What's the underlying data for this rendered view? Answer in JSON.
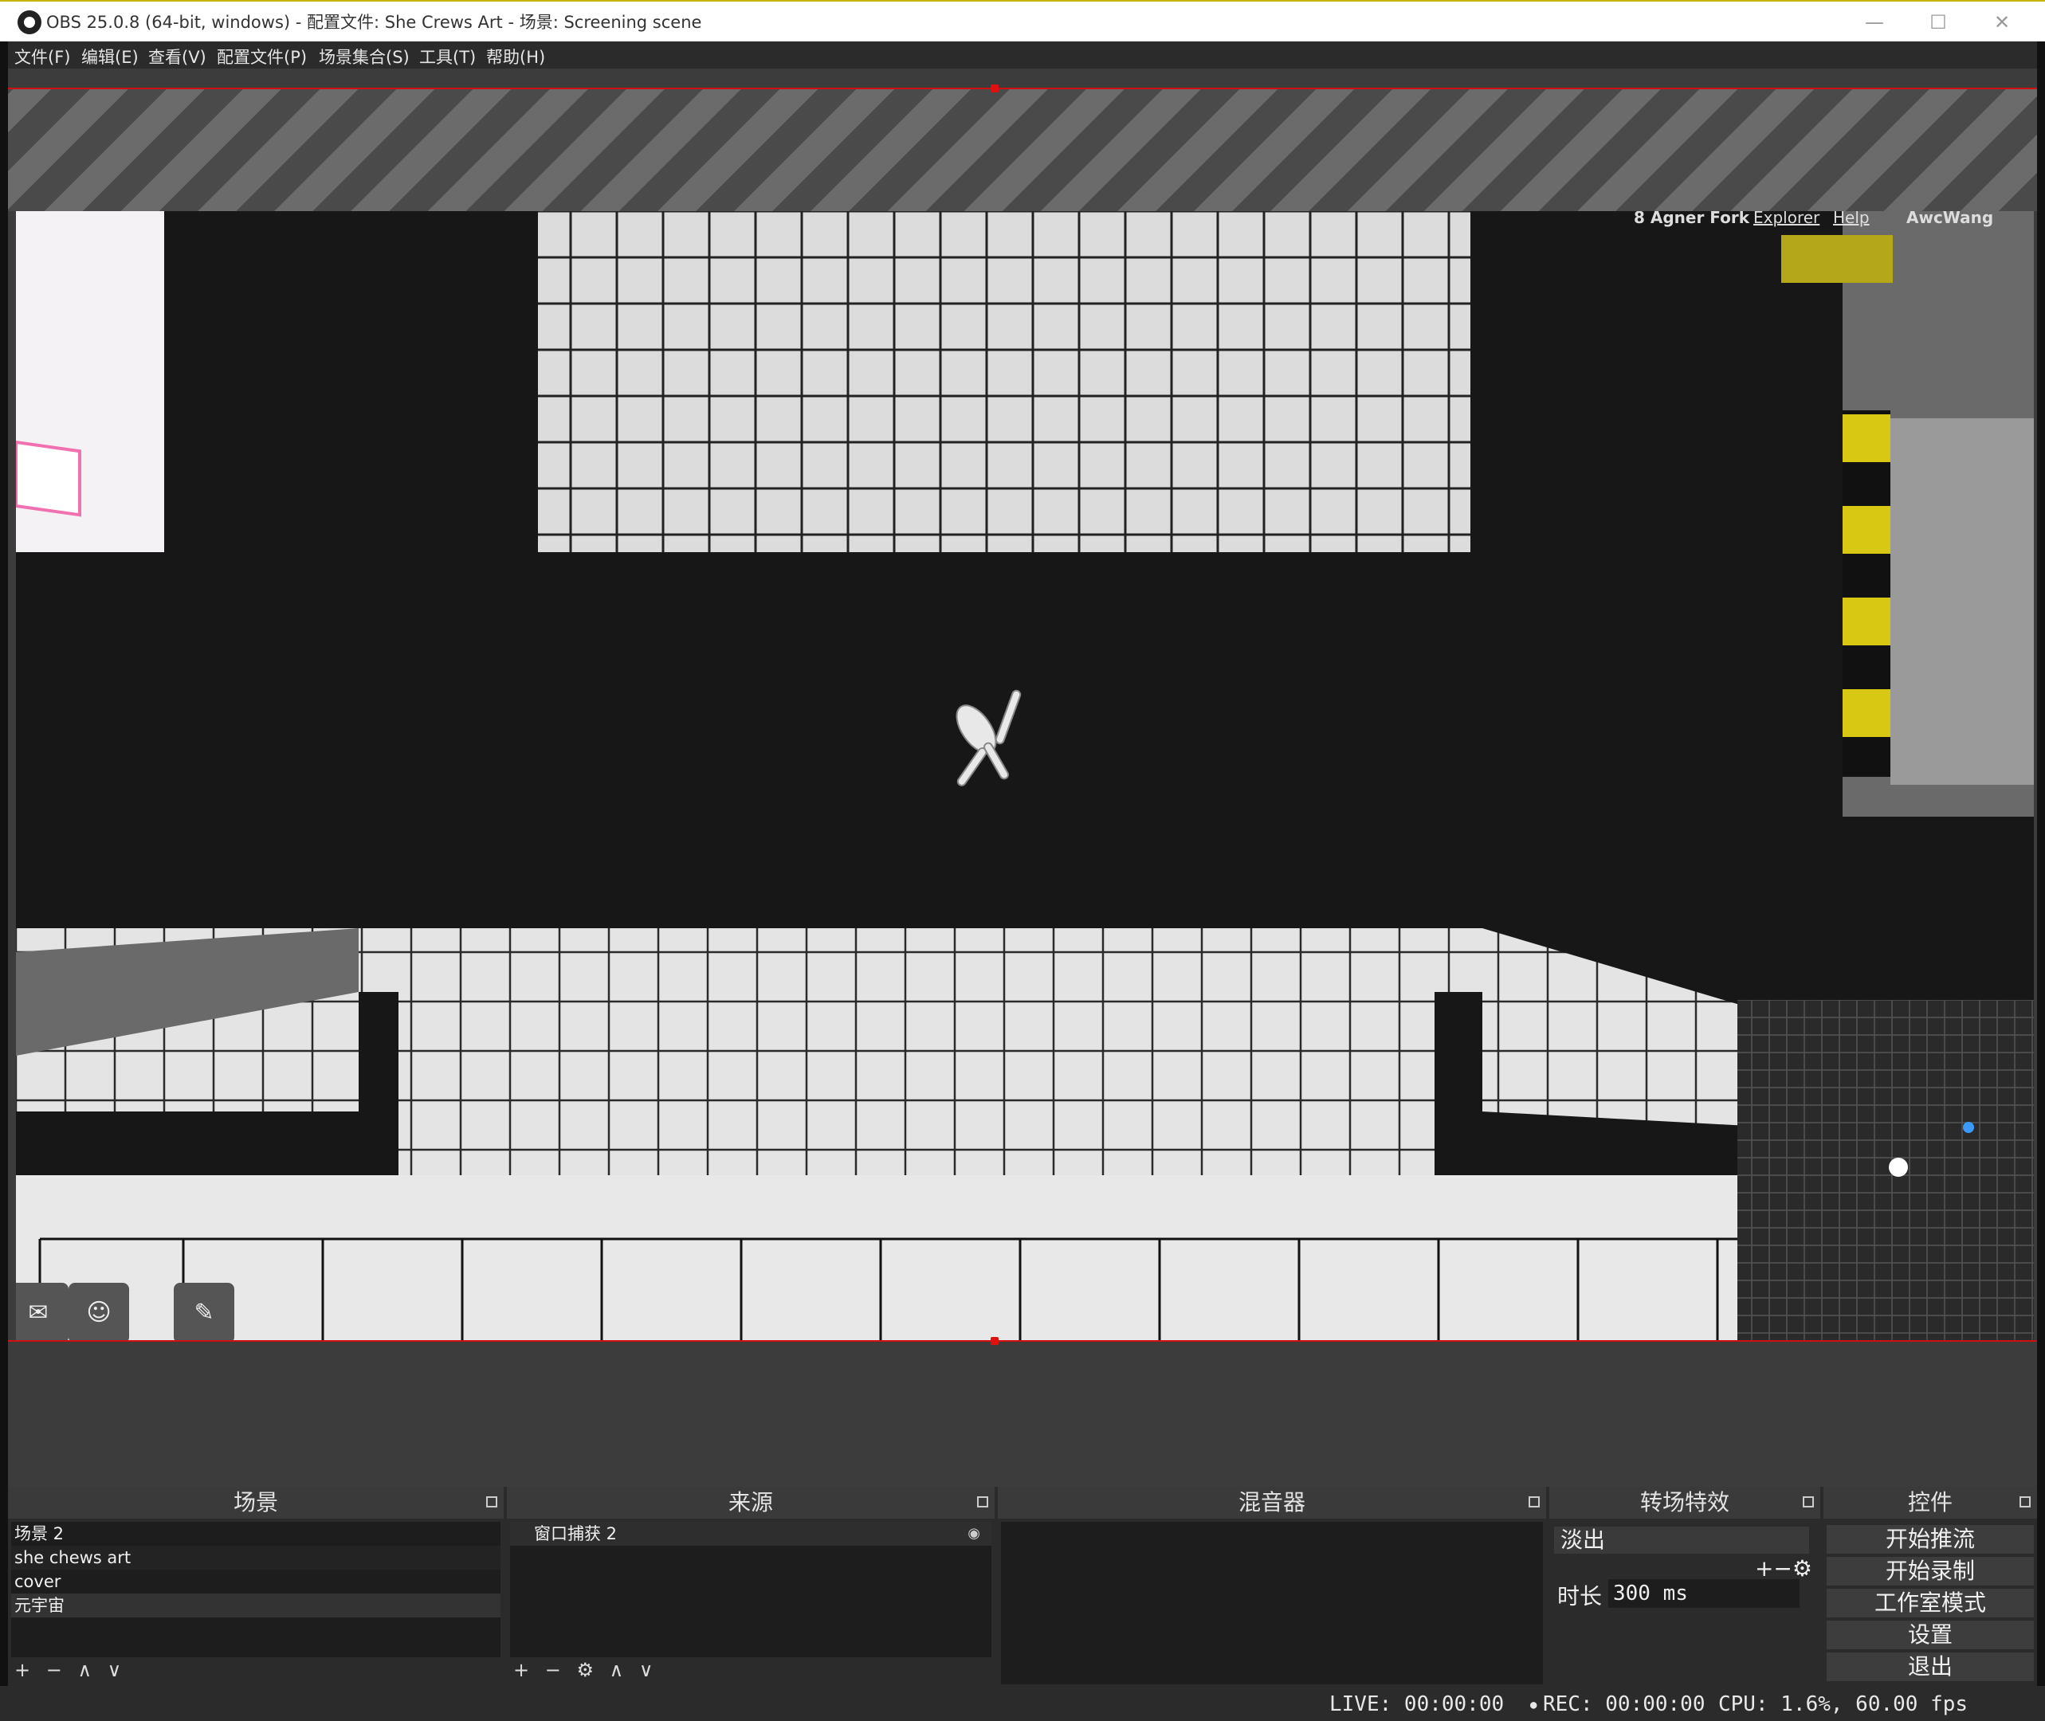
{
  "window": {
    "title": "OBS 25.0.8 (64-bit, windows) - 配置文件: She Crews Art - 场景: Screening scene",
    "minimize": "—",
    "maximize": "☐",
    "close": "✕"
  },
  "menu": {
    "items": [
      "文件(F)",
      "编辑(E)",
      "查看(V)",
      "配置文件(P)",
      "场景集合(S)",
      "工具(T)",
      "帮助(H)"
    ]
  },
  "game": {
    "topbar": {
      "location": "8 Agner Fork",
      "explorer": "Explorer",
      "help": "Help",
      "user": "AwcWang"
    },
    "chat_buttons": [
      "chat-icon",
      "emoji-icon",
      "mic-muted-icon"
    ]
  },
  "docks": {
    "scenes": {
      "title": "场景",
      "items": [
        "场景 2",
        "she chews art",
        "cover",
        "元宇宙"
      ],
      "toolbar": "+ − ∧ ∨"
    },
    "sources": {
      "title": "来源",
      "items": [
        "窗口捕获 2"
      ],
      "toolbar": "+ − ⚙ ∧ ∨"
    },
    "mixer": {
      "title": "混音器"
    },
    "transitions": {
      "title": "转场特效",
      "selected": "淡出",
      "duration_label": "时长",
      "duration_value": "300 ms",
      "add_remove": "+−⚙"
    },
    "controls": {
      "title": "控件",
      "buttons": [
        "开始推流",
        "开始录制",
        "工作室模式",
        "设置",
        "退出"
      ]
    }
  },
  "status": {
    "live": "LIVE: 00:00:00",
    "rec": "REC: 00:00:00",
    "cpu": "CPU: 1.6%, 60.00 fps"
  },
  "colors": {
    "accent_red": "#d01010",
    "hazard_yellow": "#e0c814",
    "dock_bg": "#2b2b2b"
  }
}
